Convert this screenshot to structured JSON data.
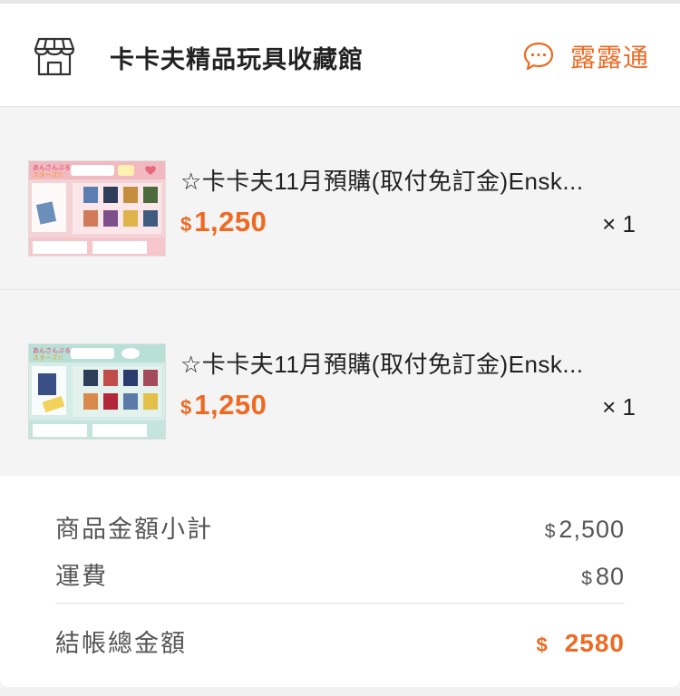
{
  "shop": {
    "name": "卡卡夫精品玩具收藏館",
    "chat_label": "露露通",
    "icon": "store-icon",
    "chat_icon": "chat-bubble-icon"
  },
  "items": [
    {
      "title": "☆卡卡夫11月預購(取付免訂金)Ensk...",
      "currency": "$",
      "price": "1,250",
      "quantity": "× 1",
      "thumb_theme": "pink"
    },
    {
      "title": "☆卡卡夫11月預購(取付免訂金)Ensk...",
      "currency": "$",
      "price": "1,250",
      "quantity": "× 1",
      "thumb_theme": "teal"
    }
  ],
  "summary": {
    "subtotal_label": "商品金額小計",
    "subtotal_currency": "$",
    "subtotal_value": "2,500",
    "shipping_label": "運費",
    "shipping_currency": "$",
    "shipping_value": "80",
    "total_label": "結帳總金額",
    "total_currency": "$",
    "total_value": "2580"
  },
  "colors": {
    "accent": "#ee6a23",
    "background": "#f4f4f4",
    "card": "#ffffff"
  }
}
